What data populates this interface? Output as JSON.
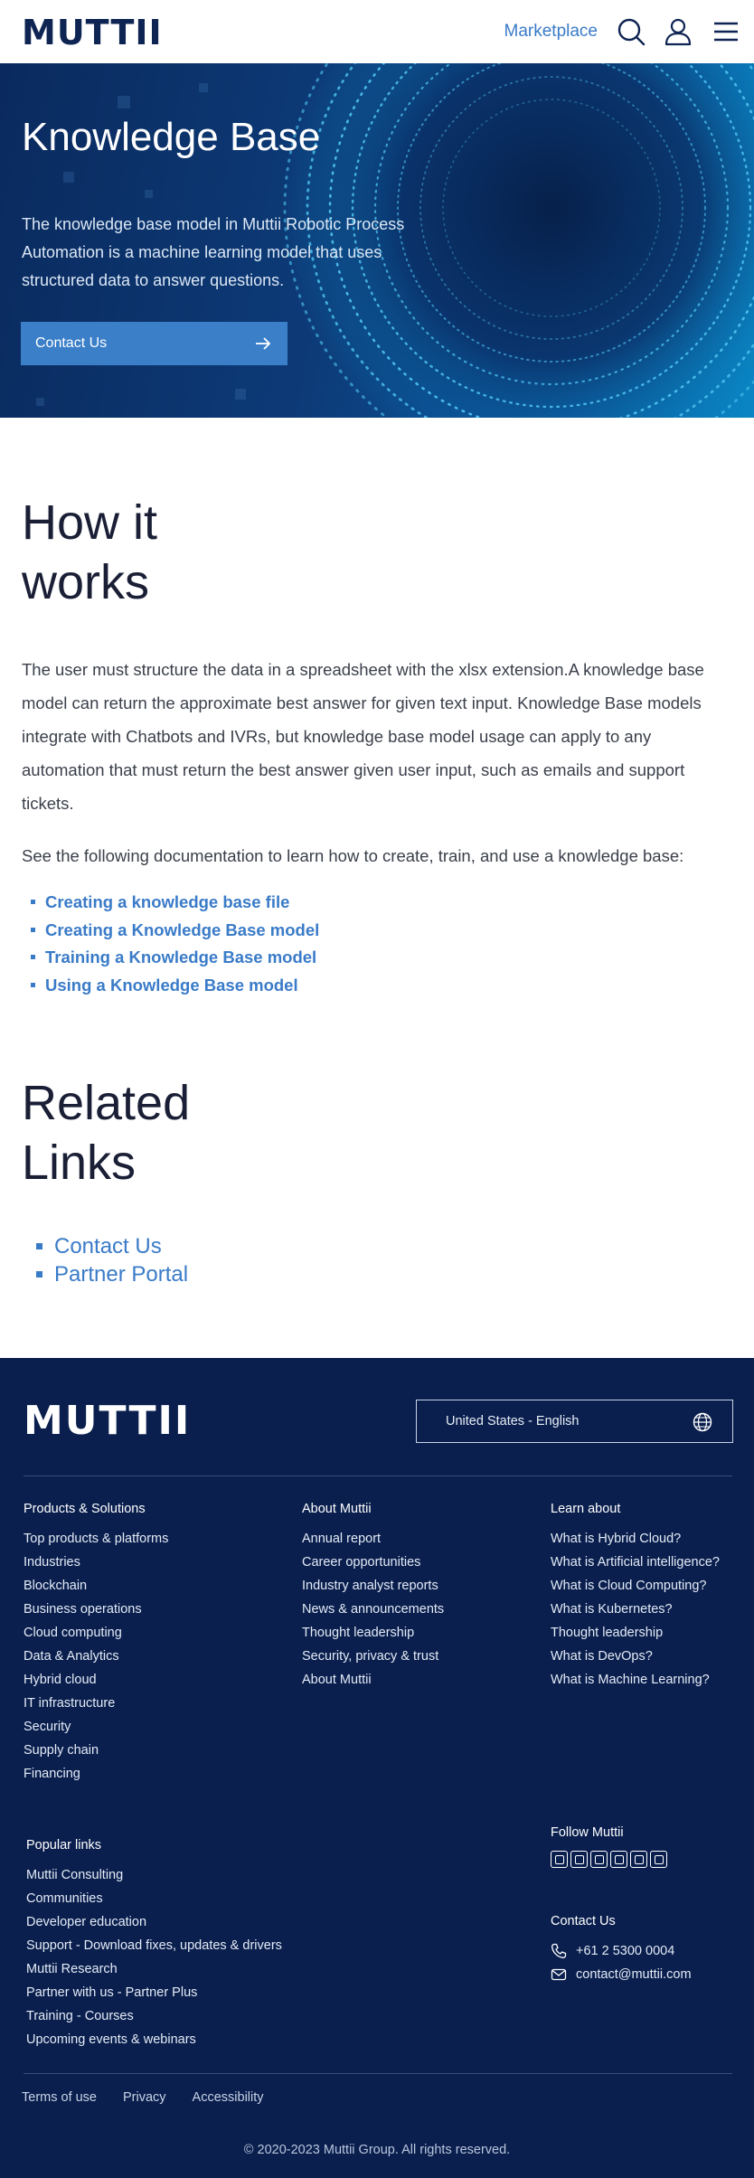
{
  "header": {
    "logo": "MUTTII",
    "marketplace_label": "Marketplace"
  },
  "hero": {
    "title": "Knowledge Base",
    "description": "The knowledge base model in Muttii Robotic Process Automation is a machine learning model that uses structured data to answer questions.",
    "button_label": "Contact Us"
  },
  "how_it_works": {
    "title": "How it works",
    "paragraph1": "The user must structure the data in a spreadsheet with the xlsx extension.A knowledge base model can return the approximate best answer for given text input. Knowledge Base models integrate with Chatbots and IVRs, but knowledge base model usage can apply to any automation that must return the best answer given user input, such as emails and support tickets.",
    "paragraph2": "See the following documentation to learn how to create, train, and use a knowledge base:",
    "links": [
      "Creating a knowledge base file",
      "Creating a Knowledge Base model",
      "Training a Knowledge Base model",
      "Using a Knowledge Base model"
    ]
  },
  "related": {
    "title": "Related Links",
    "links": [
      "Contact Us",
      "Partner Portal"
    ]
  },
  "footer": {
    "logo": "MUTTII",
    "language": "United States - English",
    "products": {
      "heading": "Products & Solutions",
      "items": [
        "Top products & platforms",
        "Industries",
        "Blockchain",
        "Business operations",
        "Cloud computing",
        "Data & Analytics",
        "Hybrid cloud",
        "IT infrastructure",
        "Security",
        "Supply chain",
        "Financing"
      ]
    },
    "about": {
      "heading": "About Muttii",
      "items": [
        "Annual report",
        "Career opportunities",
        "Industry analyst reports",
        "News & announcements",
        "Thought leadership",
        "Security, privacy & trust",
        "About Muttii"
      ]
    },
    "learn": {
      "heading": "Learn about",
      "items": [
        "What is Hybrid Cloud?",
        "What is Artificial intelligence?",
        "What is Cloud Computing?",
        "What is Kubernetes?",
        "Thought leadership",
        "What is DevOps?",
        "What is Machine Learning?"
      ]
    },
    "popular": {
      "heading": "Popular links",
      "items": [
        "Muttii Consulting",
        "Communities",
        "Developer education",
        "Support - Download fixes, updates & drivers",
        "Muttii Research",
        "Partner with us - Partner Plus",
        "Training - Courses",
        "Upcoming events & webinars"
      ]
    },
    "follow": {
      "heading": "Follow Muttii",
      "icons": [
        "linkedin-icon",
        "facebook-icon",
        "twitter-icon",
        "instagram-icon",
        "pinterest-icon",
        "camera-icon"
      ]
    },
    "contact": {
      "heading": "Contact Us",
      "phone": "+61 2 5300 0004",
      "email": "contact@muttii.com"
    },
    "bottom_links": [
      "Terms of use",
      "Privacy",
      "Accessibility"
    ],
    "copyright": "© 2020-2023 Muttii Group. All rights reserved."
  },
  "colors": {
    "navy": "#0a1f4e",
    "accent_blue": "#3a7bc8",
    "hero_gradient_start": "#0a2a5e",
    "hero_gradient_end": "#0a86c4"
  }
}
